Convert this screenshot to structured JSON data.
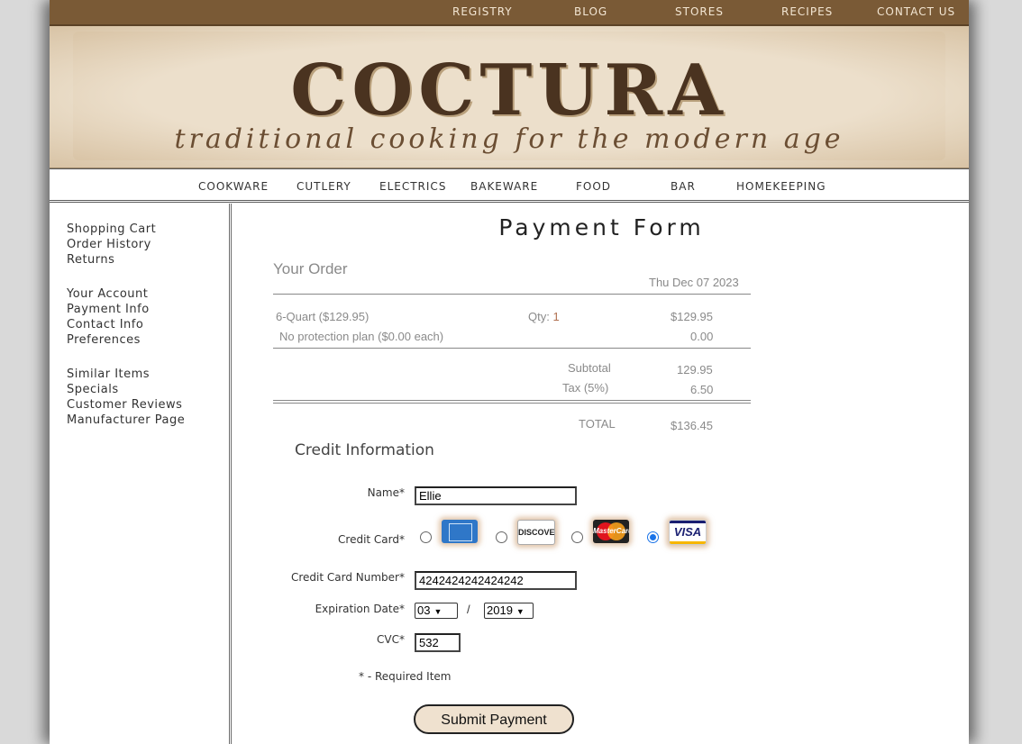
{
  "top_nav": [
    "REGISTRY",
    "BLOG",
    "STORES",
    "RECIPES",
    "CONTACT US"
  ],
  "banner": {
    "logo": "COCTURA",
    "tagline": "traditional cooking for the modern age"
  },
  "category_nav": [
    "COOKWARE",
    "CUTLERY",
    "ELECTRICS",
    "BAKEWARE",
    "FOOD",
    "BAR",
    "HOMEKEEPING"
  ],
  "sidebar": {
    "group1": [
      "Shopping Cart",
      "Order History",
      "Returns"
    ],
    "group2": [
      "Your Account",
      "Payment Info",
      "Contact Info",
      "Preferences"
    ],
    "group3": [
      "Similar Items",
      "Specials",
      "Customer Reviews",
      "Manufacturer Page"
    ]
  },
  "page_title": "Payment Form",
  "order": {
    "heading": "Your Order",
    "date": "Thu Dec 07 2023",
    "item_name": "6-Quart ($129.95)",
    "qty_label": "Qty:",
    "qty_value": "1",
    "item_price": "$129.95",
    "protection": "No protection plan ($0.00 each)",
    "protection_price": "0.00",
    "subtotal_label": "Subtotal",
    "subtotal_value": "129.95",
    "tax_label": "Tax (5%)",
    "tax_value": "6.50",
    "total_label": "TOTAL",
    "total_value": "$136.45"
  },
  "credit": {
    "heading": "Credit Information",
    "name_label": "Name*",
    "name_value": "Ellie",
    "card_label": "Credit Card*",
    "cards": [
      "amex-icon",
      "discover-icon",
      "mastercard-icon",
      "visa-icon"
    ],
    "card_text": {
      "discover": "DISCOVER",
      "master": "MasterCard",
      "visa": "VISA"
    },
    "selected_card": "visa",
    "number_label": "Credit Card Number*",
    "number_value": "4242424242424242",
    "expiry_label": "Expiration Date*",
    "expiry_month": "03",
    "expiry_sep": "/",
    "expiry_year": "2019",
    "cvc_label": "CVC*",
    "cvc_value": "532",
    "required_note": "* - Required Item",
    "submit_label": "Submit Payment"
  },
  "colors": {
    "topbar": "#7a5a36",
    "banner": "#ecdfcb",
    "submit_bg": "#efe1cf",
    "radio_selected": "#1a73e8"
  }
}
